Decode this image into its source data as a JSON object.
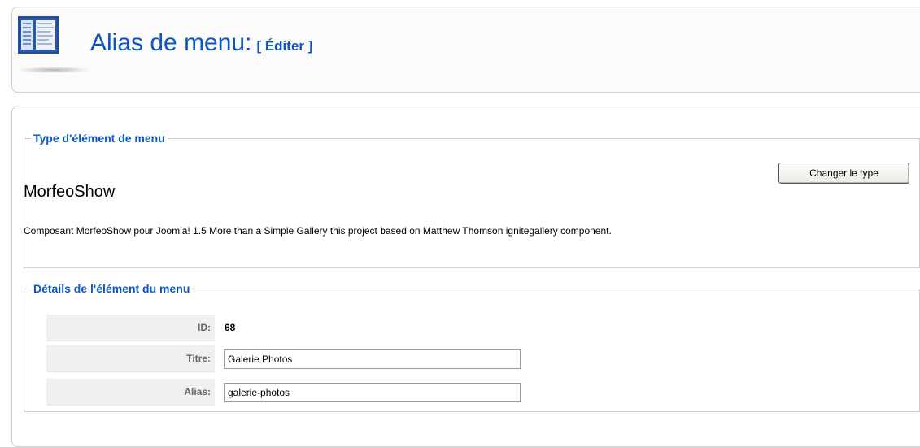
{
  "header": {
    "title": "Alias de menu:",
    "subtitle": "[ Éditer ]"
  },
  "type_section": {
    "legend": "Type d'élément de menu",
    "change_button": "Changer le type",
    "type_name": "MorfeoShow",
    "description": "Composant MorfeoShow pour Joomla! 1.5 More than a Simple Gallery this project based on Matthew Thomson ignitegallery component."
  },
  "details_section": {
    "legend": "Détails de l'élément du menu",
    "id": {
      "label": "ID:",
      "value": "68"
    },
    "title": {
      "label": "Titre:",
      "value": "Galerie Photos"
    },
    "alias": {
      "label": "Alias:",
      "value": "galerie-photos"
    }
  },
  "colors": {
    "title_blue": "#0b55c4",
    "legend_blue": "#0b55c4",
    "label_gray": "#666666",
    "row_bg": "#f0f0f0"
  },
  "icons": {
    "header_icon": "menu-manager-icon"
  }
}
